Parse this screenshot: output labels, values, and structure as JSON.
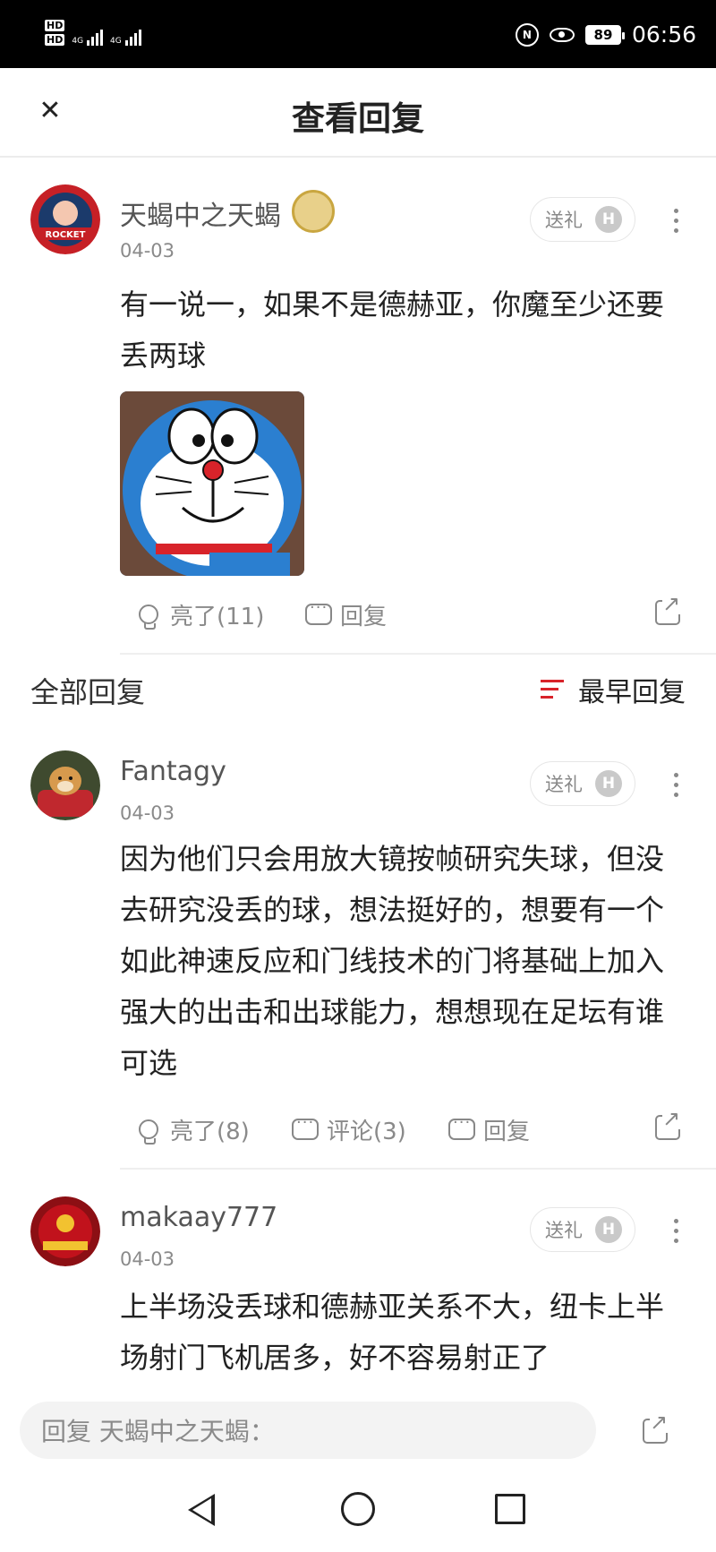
{
  "status_bar": {
    "hd_top": "HD",
    "hd_bottom": "HD",
    "network_1": "4G",
    "network_2": "4G",
    "nfc": "N",
    "battery": "89",
    "time": "06:56"
  },
  "header": {
    "title": "查看回复",
    "close_icon": "close-icon"
  },
  "main_comment": {
    "username": "天蝎中之天蝎",
    "date": "04-03",
    "gift_label": "送礼",
    "gift_badge": "H",
    "text": "有一说一，如果不是德赫亚，你魔至少还要丢两球",
    "sticker": "doraemon-sticker",
    "like_label": "亮了(11)",
    "reply_label": "回复"
  },
  "section": {
    "title": "全部回复",
    "sort_label": "最早回复"
  },
  "replies": [
    {
      "username": "Fantagy",
      "date": "04-03",
      "gift_label": "送礼",
      "gift_badge": "H",
      "text": "因为他们只会用放大镜按帧研究失球，但没去研究没丢的球，想法挺好的，想要有一个如此神速反应和门线技术的门将基础上加入强大的出击和出球能力，想想现在足坛有谁可选",
      "like_label": "亮了(8)",
      "comment_label": "评论(3)",
      "reply_label": "回复"
    },
    {
      "username": "makaay777",
      "date": "04-03",
      "gift_label": "送礼",
      "gift_badge": "H",
      "text": "上半场没丢球和德赫亚关系不大，纽卡上半场射门飞机居多，好不容易射正了"
    }
  ],
  "reply_bar": {
    "placeholder": "回复 天蝎中之天蝎："
  },
  "colors": {
    "accent": "#d8232a",
    "text_primary": "#222222",
    "text_secondary": "#8a8a8a"
  }
}
